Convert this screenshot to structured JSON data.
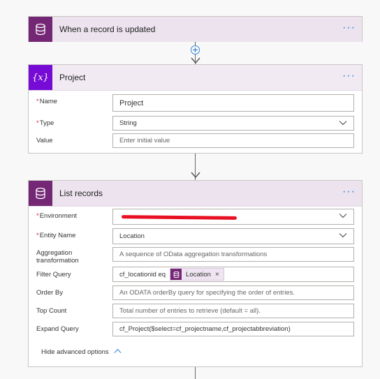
{
  "trigger": {
    "title": "When a record is updated",
    "more": "···"
  },
  "project_card": {
    "title": "Project",
    "more": "···",
    "fields": [
      {
        "label": "Name",
        "required": true,
        "value": "Project"
      },
      {
        "label": "Type",
        "required": true,
        "value": "String"
      },
      {
        "label": "Value",
        "required": false,
        "placeholder": "Enter initial value"
      }
    ]
  },
  "list_records": {
    "title": "List records",
    "more": "···",
    "environment_label": "Environment",
    "entity_label": "Entity Name",
    "entity_value": "Location",
    "aggregation_label": "Aggregation transformation",
    "aggregation_placeholder": "A sequence of OData aggregation transformations",
    "filter_label": "Filter Query",
    "filter_text": "cf_locationid eq",
    "filter_token": "Location",
    "filter_token_close": "×",
    "orderby_label": "Order By",
    "orderby_placeholder": "An ODATA orderBy query for specifying the order of entries.",
    "topcount_label": "Top Count",
    "topcount_placeholder": "Total number of entries to retrieve (default = all).",
    "expand_label": "Expand Query",
    "expand_value": "cf_Project($select=cf_projectname,cf_projectabbreviation)",
    "hide_advanced": "Hide advanced options"
  },
  "colors": {
    "accent": "#742774",
    "variable": "#770bd6",
    "link": "#2f7fd0",
    "required": "#d13438",
    "redaction": "#e81123"
  }
}
